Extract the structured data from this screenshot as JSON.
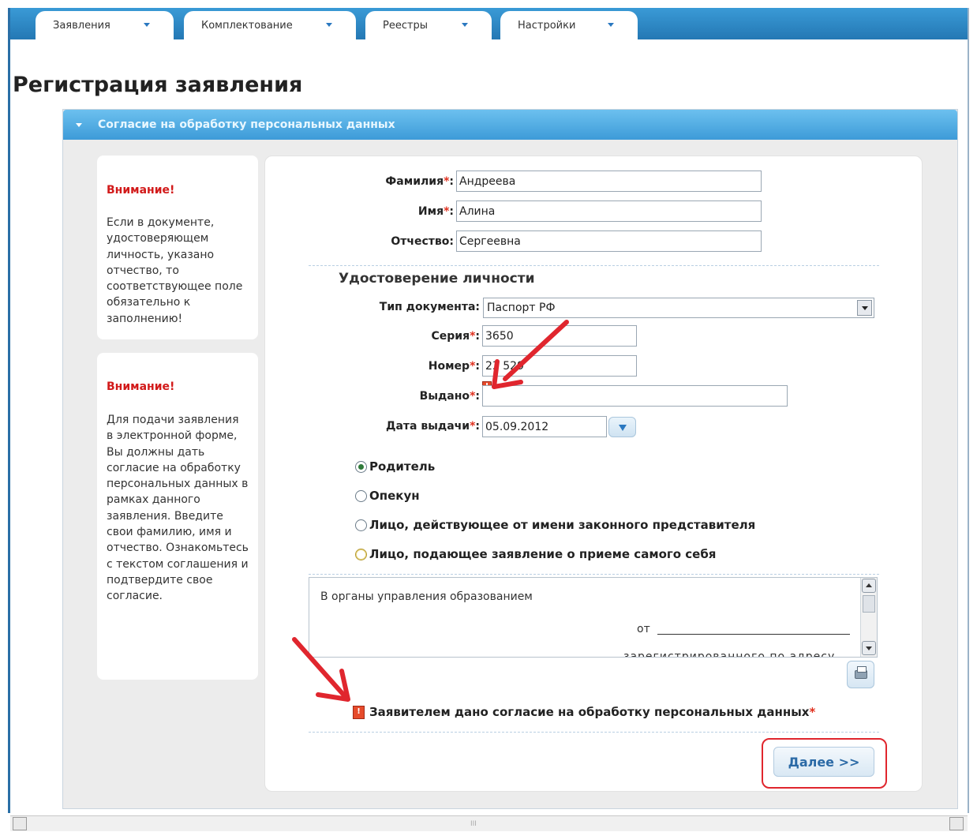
{
  "nav": {
    "tabs": [
      {
        "label": "Заявления"
      },
      {
        "label": "Комплектование"
      },
      {
        "label": "Реестры"
      },
      {
        "label": "Настройки"
      }
    ]
  },
  "page": {
    "title": "Регистрация заявления"
  },
  "panel": {
    "title": "Согласие на обработку персональных данных"
  },
  "notes": [
    {
      "heading": "Внимание!",
      "text": "Если в документе, удостоверяющем личность, указано отчество, то соответствующее поле обязательно к заполнению!"
    },
    {
      "heading": "Внимание!",
      "text": "Для подачи заявления в электронной форме, Вы должны дать согласие на обработку персональных данных в рамках данного заявления. Введите свои фамилию, имя и отчество. Ознакомьтесь с текстом соглашения и подтвердите свое согласие."
    }
  ],
  "form": {
    "surname": {
      "label": "Фамилия",
      "value": "Андреева"
    },
    "name": {
      "label": "Имя",
      "value": "Алина"
    },
    "patronymic": {
      "label": "Отчество:",
      "value": "Сергеевна"
    },
    "id_section_title": "Удостоверение личности",
    "doc_type": {
      "label": "Тип документа:",
      "value": "Паспорт РФ"
    },
    "series": {
      "label": "Серия",
      "value": "3650"
    },
    "number": {
      "label": "Номер",
      "value": "23 529"
    },
    "issued_by": {
      "label": "Выдано",
      "value": ""
    },
    "issue_date": {
      "label": "Дата выдачи",
      "value": "05.09.2012"
    },
    "required_mark": "*",
    "colon": ":",
    "error_mark": "!",
    "applicant_roles": [
      {
        "label": "Родитель",
        "selected": true
      },
      {
        "label": "Опекун",
        "selected": false
      },
      {
        "label": "Лицо, действующее от имени законного представителя",
        "selected": false
      },
      {
        "label": "Лицо, подающее заявление о приеме самого себя",
        "selected": false
      }
    ],
    "agreement": {
      "line1": "В органы управления образованием",
      "line2": "от",
      "line3": "зарегистрированного по адресу"
    },
    "consent_label": "Заявителем дано согласие на обработку персональных данных",
    "next_button": "Далее >>"
  },
  "scrollbar": {
    "grip": "III"
  },
  "colors": {
    "accent": "#3d9bd8",
    "warning": "#d21a1a",
    "required": "#e0301e",
    "annotation": "#e0262e"
  }
}
